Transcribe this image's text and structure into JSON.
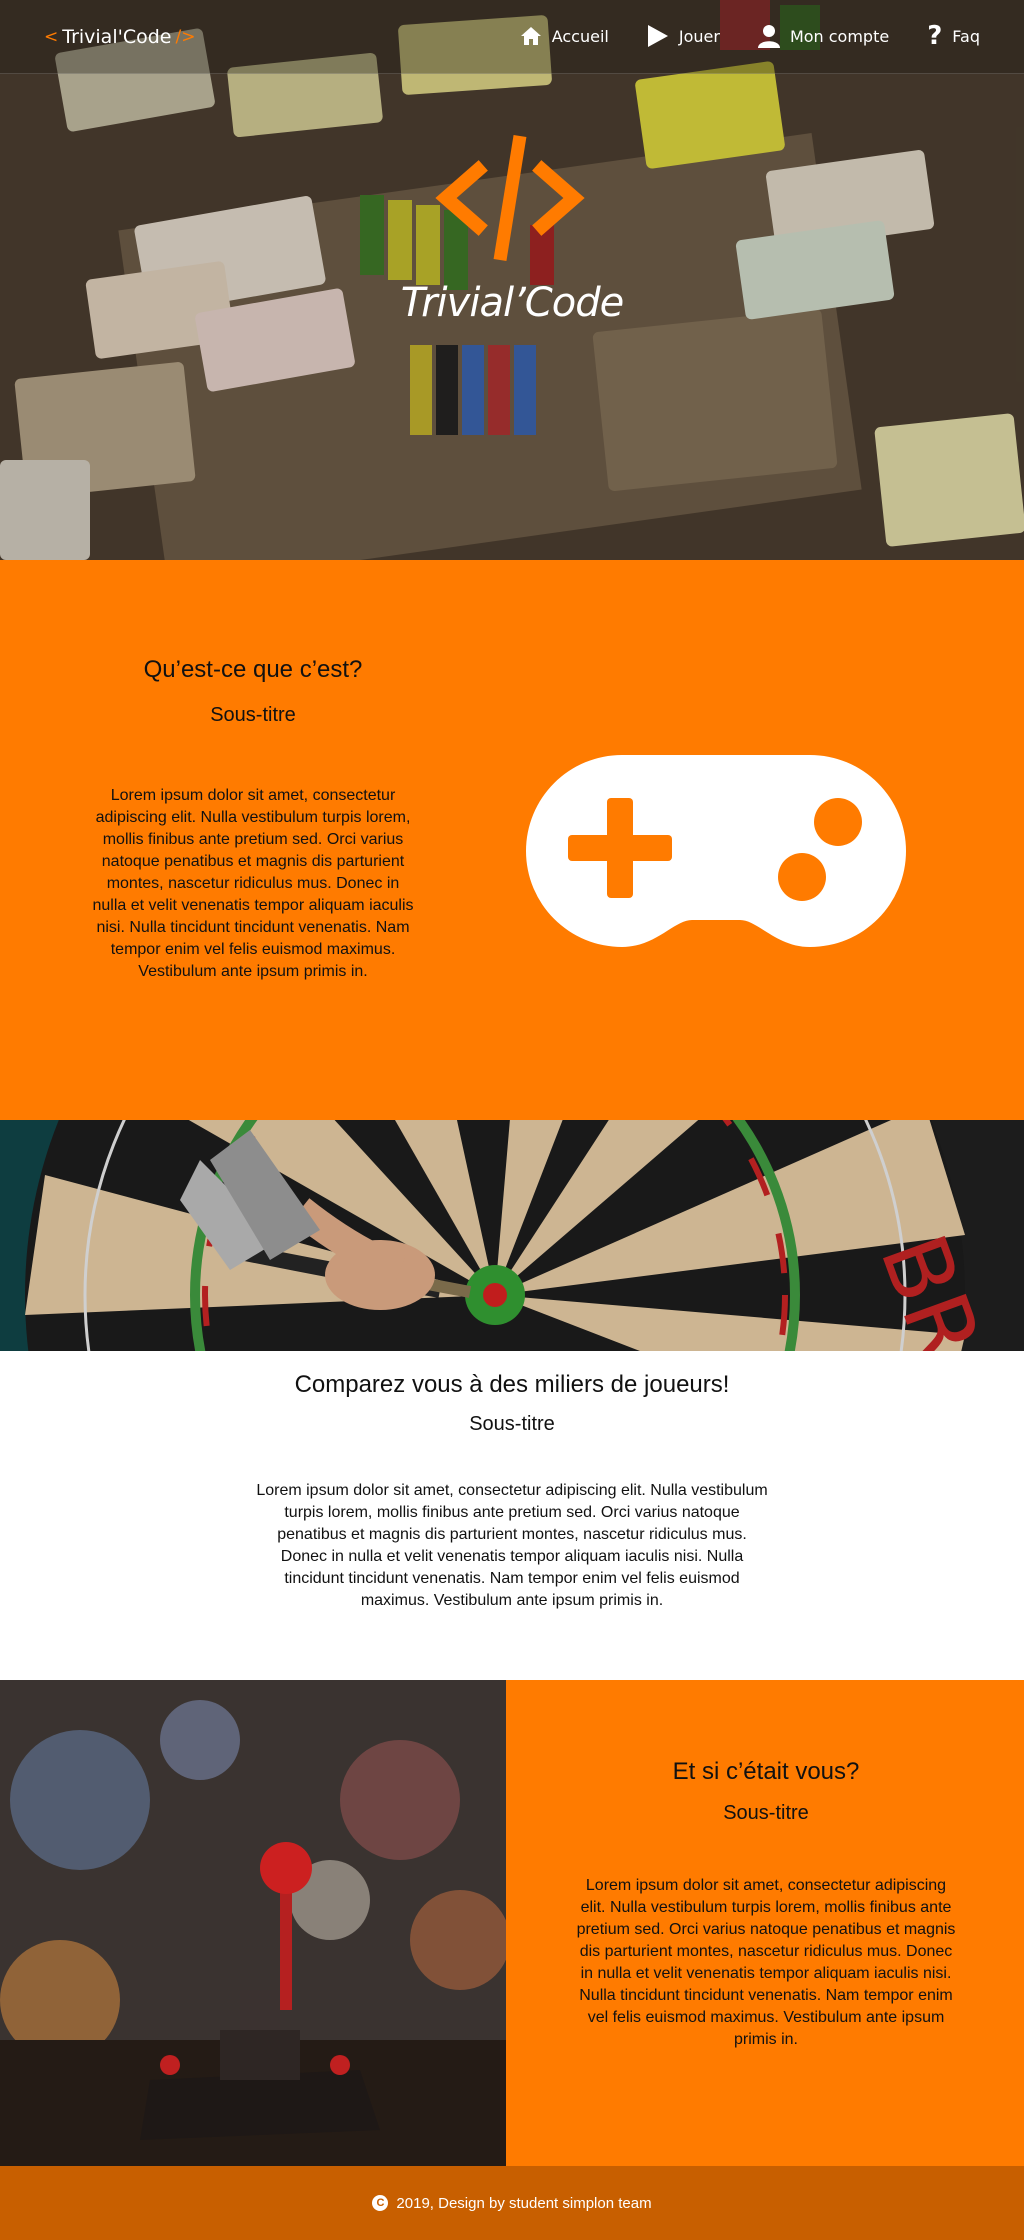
{
  "nav": {
    "brand_open": "<",
    "brand_name": "Trivial'Code",
    "brand_close": "/>",
    "items": [
      {
        "label": "Accueil",
        "icon": "home-icon"
      },
      {
        "label": "Jouer",
        "icon": "play-icon"
      },
      {
        "label": "Mon compte",
        "icon": "user-icon"
      },
      {
        "label": "Faq",
        "icon": "question-icon"
      }
    ]
  },
  "hero": {
    "title": "Trivial’Code"
  },
  "section1": {
    "title": "Qu’est-ce que c’est?",
    "subtitle": "Sous-titre",
    "text": "Lorem ipsum dolor sit amet, consectetur adipiscing elit. Nulla vestibulum turpis lorem, mollis finibus ante pretium sed. Orci varius natoque penatibus et magnis dis parturient montes, nascetur ridiculus mus. Donec in nulla et velit venenatis tempor aliquam iaculis nisi. Nulla tincidunt tincidunt venenatis. Nam tempor enim vel felis euismod maximus. Vestibulum ante ipsum primis in."
  },
  "section2": {
    "title": "Comparez vous à des miliers de joueurs!",
    "subtitle": "Sous-titre",
    "text": "Lorem ipsum dolor sit amet, consectetur adipiscing elit. Nulla vestibulum turpis lorem, mollis finibus ante pretium sed. Orci varius natoque penatibus et magnis dis parturient montes, nascetur ridiculus mus. Donec in nulla et velit venenatis tempor aliquam iaculis nisi. Nulla tincidunt tincidunt venenatis. Nam tempor enim vel felis euismod maximus. Vestibulum ante ipsum primis in."
  },
  "section3": {
    "title": "Et si c’était vous?",
    "subtitle": "Sous-titre",
    "text": "Lorem ipsum dolor sit amet, consectetur adipiscing elit. Nulla vestibulum turpis lorem, mollis finibus ante pretium sed. Orci varius natoque penatibus et magnis dis parturient montes, nascetur ridiculus mus. Donec in nulla et velit venenatis tempor aliquam iaculis nisi. Nulla tincidunt tincidunt venenatis. Nam tempor enim vel felis euismod maximus. Vestibulum ante ipsum primis in."
  },
  "footer": {
    "text": "2019, Design by student simplon team"
  },
  "colors": {
    "accent": "#ff7b00",
    "footer": "#c85f00",
    "white": "#ffffff"
  }
}
